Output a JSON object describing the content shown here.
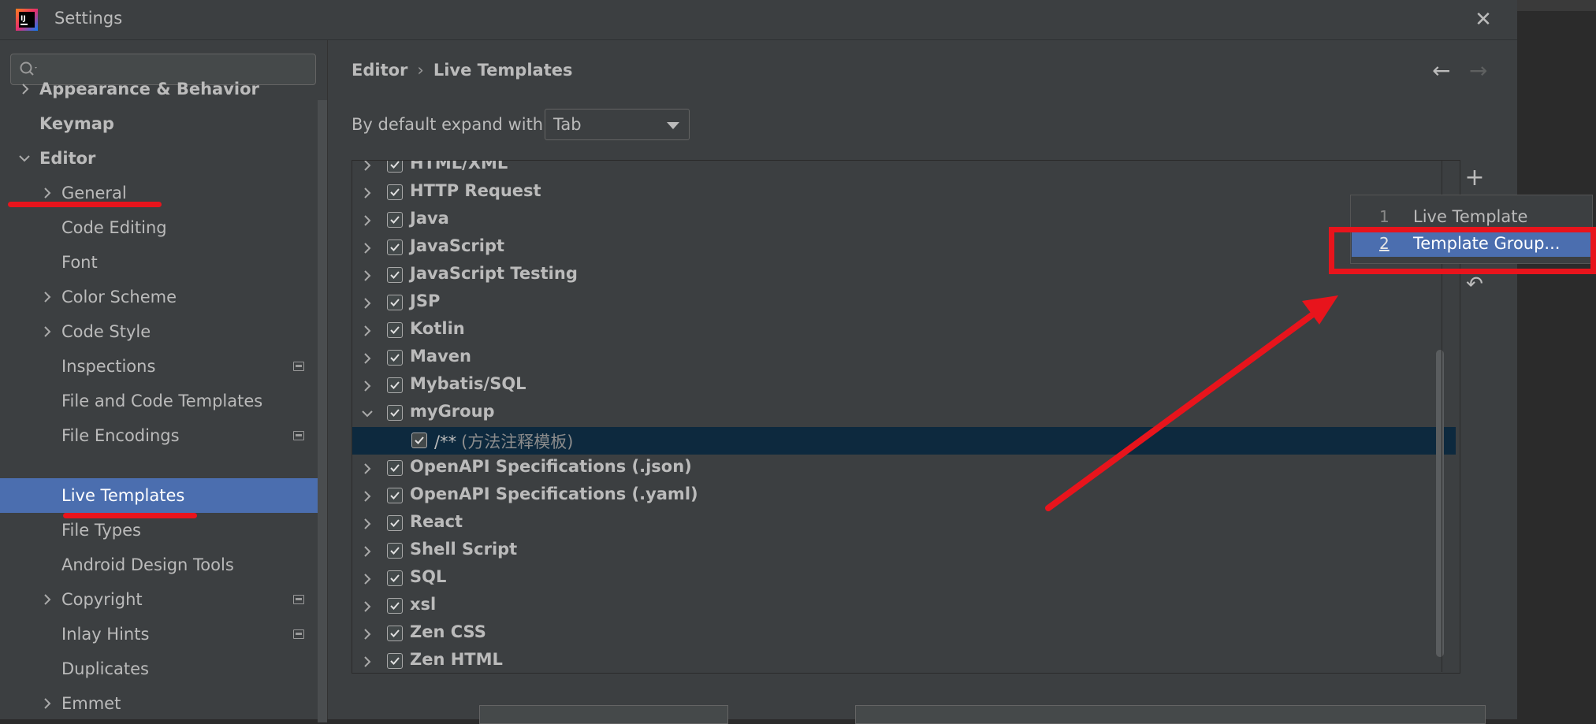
{
  "window": {
    "title": "Settings"
  },
  "search": {
    "placeholder": ""
  },
  "sidebar": {
    "items": [
      {
        "label": "Appearance & Behavior"
      },
      {
        "label": "Keymap"
      },
      {
        "label": "Editor"
      },
      {
        "label": "General"
      },
      {
        "label": "Code Editing"
      },
      {
        "label": "Font"
      },
      {
        "label": "Color Scheme"
      },
      {
        "label": "Code Style"
      },
      {
        "label": "Inspections"
      },
      {
        "label": "File and Code Templates"
      },
      {
        "label": "File Encodings"
      },
      {
        "label": "Live Templates"
      },
      {
        "label": "File Types"
      },
      {
        "label": "Android Design Tools"
      },
      {
        "label": "Copyright"
      },
      {
        "label": "Inlay Hints"
      },
      {
        "label": "Duplicates"
      },
      {
        "label": "Emmet"
      }
    ]
  },
  "breadcrumb": {
    "parent": "Editor",
    "separator": "›",
    "current": "Live Templates"
  },
  "expand": {
    "label": "By default expand with",
    "value": "Tab"
  },
  "templates": {
    "groups": [
      {
        "label": "HTML/XML"
      },
      {
        "label": "HTTP Request"
      },
      {
        "label": "Java"
      },
      {
        "label": "JavaScript"
      },
      {
        "label": "JavaScript Testing"
      },
      {
        "label": "JSP"
      },
      {
        "label": "Kotlin"
      },
      {
        "label": "Maven"
      },
      {
        "label": "Mybatis/SQL"
      },
      {
        "label": "myGroup"
      },
      {
        "label": "/**",
        "description": "(方法注释模板)"
      },
      {
        "label": "OpenAPI Specifications (.json)"
      },
      {
        "label": "OpenAPI Specifications (.yaml)"
      },
      {
        "label": "React"
      },
      {
        "label": "Shell Script"
      },
      {
        "label": "SQL"
      },
      {
        "label": "xsl"
      },
      {
        "label": "Zen CSS"
      },
      {
        "label": "Zen HTML"
      }
    ]
  },
  "popup": {
    "items": [
      {
        "num": "1",
        "label": "Live Template"
      },
      {
        "num": "2",
        "label": "Template Group..."
      }
    ]
  },
  "colors": {
    "accent": "#4b6eaf",
    "annotation": "#e8141c",
    "highlight_row": "#0d293e"
  },
  "icons": [
    "app-logo",
    "search-icon",
    "close-icon",
    "chevron-right-icon",
    "chevron-down-icon",
    "add-icon",
    "undo-icon",
    "back-arrow-icon",
    "forward-arrow-icon"
  ]
}
